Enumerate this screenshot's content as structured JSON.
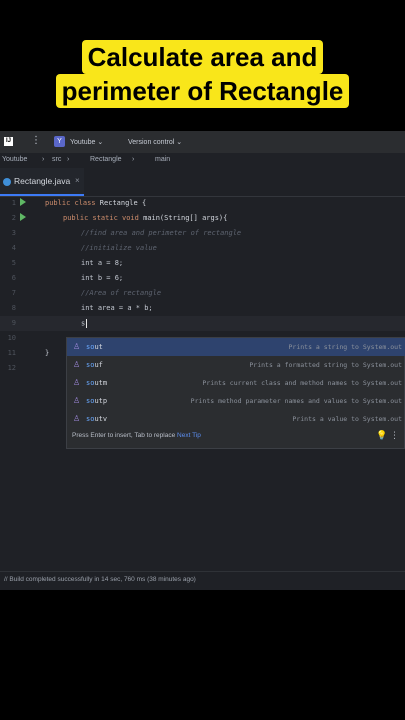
{
  "caption": {
    "line1": "Calculate area and",
    "line2": "perimeter of Rectangle"
  },
  "toolbar": {
    "project_badge": "Y",
    "project": "Youtube ⌄",
    "vcs": "Version control ⌄"
  },
  "breadcrumb": [
    "Youtube",
    "src",
    "Rectangle",
    "main"
  ],
  "tab": {
    "name": "Rectangle.java",
    "close": "×"
  },
  "gutter": [
    "1",
    "2",
    "3",
    "4",
    "5",
    "6",
    "7",
    "8",
    "9",
    "10",
    "11",
    "12"
  ],
  "code": {
    "l1_kw": "public class ",
    "l1_name": "Rectangle {",
    "l2_kw": "public static void ",
    "l2_name": "main(String[] args){",
    "l3": "//find area and perimeter of rectangle",
    "l4": "//initialize value",
    "l5": "int a = 8;",
    "l6": "int b = 6;",
    "l7": "//Area of rectangle",
    "l8": "int area = a * b;",
    "l9": "s",
    "l11": "}"
  },
  "completion": {
    "items": [
      {
        "prefix": "so",
        "rest": "ut",
        "desc": "Prints a string to System.out"
      },
      {
        "prefix": "so",
        "rest": "uf",
        "desc": "Prints a formatted string to System.out"
      },
      {
        "prefix": "so",
        "rest": "utm",
        "desc": "Prints current class and method names to System.out"
      },
      {
        "prefix": "so",
        "rest": "utp",
        "desc": "Prints method parameter names and values to System.out"
      },
      {
        "prefix": "so",
        "rest": "utv",
        "desc": "Prints a value to System.out"
      }
    ],
    "footer": "Press Enter to insert, Tab to replace",
    "footer_link": "Next Tip"
  },
  "status": "// Build completed successfully in 14 sec, 760 ms (38 minutes ago)"
}
